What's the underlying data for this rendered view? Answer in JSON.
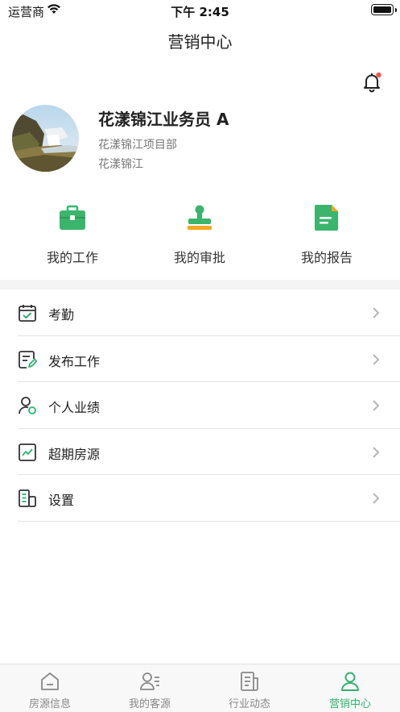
{
  "status_bar": {
    "carrier": "运营商",
    "time": "下午 2:45"
  },
  "nav": {
    "title": "营销中心",
    "notification_icon": "bell-icon"
  },
  "profile": {
    "name": "花漾锦江业务员 A",
    "project": "花漾锦江项目部",
    "organization": "花漾锦江"
  },
  "quick_actions": [
    {
      "label": "我的工作",
      "icon": "briefcase-icon"
    },
    {
      "label": "我的审批",
      "icon": "stamp-icon"
    },
    {
      "label": "我的报告",
      "icon": "report-icon"
    }
  ],
  "menu": [
    {
      "label": "考勤",
      "icon": "calendar-check-icon"
    },
    {
      "label": "发布工作",
      "icon": "edit-note-icon"
    },
    {
      "label": "个人业绩",
      "icon": "user-performance-icon"
    },
    {
      "label": "超期房源",
      "icon": "trend-chart-icon"
    },
    {
      "label": "设置",
      "icon": "settings-building-icon"
    }
  ],
  "tab_bar": [
    {
      "label": "房源信息",
      "icon": "home-icon",
      "active": false
    },
    {
      "label": "我的客源",
      "icon": "contacts-icon",
      "active": false
    },
    {
      "label": "行业动态",
      "icon": "news-icon",
      "active": false
    },
    {
      "label": "营销中心",
      "icon": "user-icon",
      "active": true
    }
  ],
  "colors": {
    "accent": "#2db36e",
    "quick_icon_green": "#3bb56b",
    "quick_icon_orange": "#f5a623",
    "notification_dot": "#f0544f",
    "separator": "#f4f4f4",
    "inactive_tab": "#888888"
  }
}
